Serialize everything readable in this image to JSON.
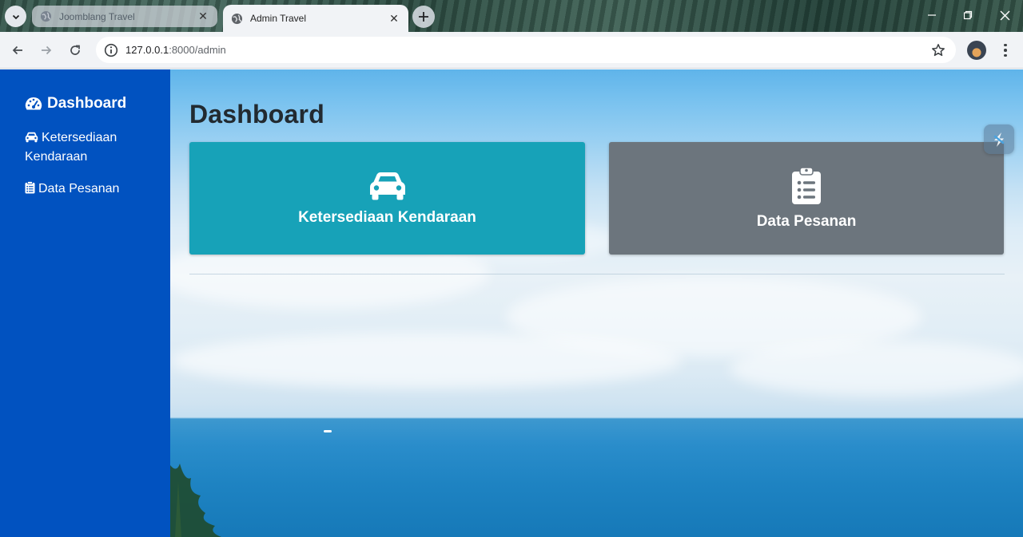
{
  "browser": {
    "tabs": [
      {
        "title": "Joomblang Travel",
        "active": false
      },
      {
        "title": "Admin Travel",
        "active": true
      }
    ],
    "url_host": "127.0.0.1",
    "url_rest": ":8000/admin"
  },
  "sidebar": {
    "brand": "Dashboard",
    "items": [
      {
        "label": "Ketersediaan Kendaraan",
        "icon": "car-icon"
      },
      {
        "label": "Data Pesanan",
        "icon": "clipboard-icon"
      }
    ]
  },
  "main": {
    "title": "Dashboard",
    "cards": [
      {
        "label": "Ketersediaan Kendaraan",
        "icon": "car-icon",
        "color": "#17a2b8"
      },
      {
        "label": "Data Pesanan",
        "icon": "clipboard-list-icon",
        "color": "#6c757d"
      }
    ]
  },
  "colors": {
    "sidebar": "#0152c0"
  }
}
